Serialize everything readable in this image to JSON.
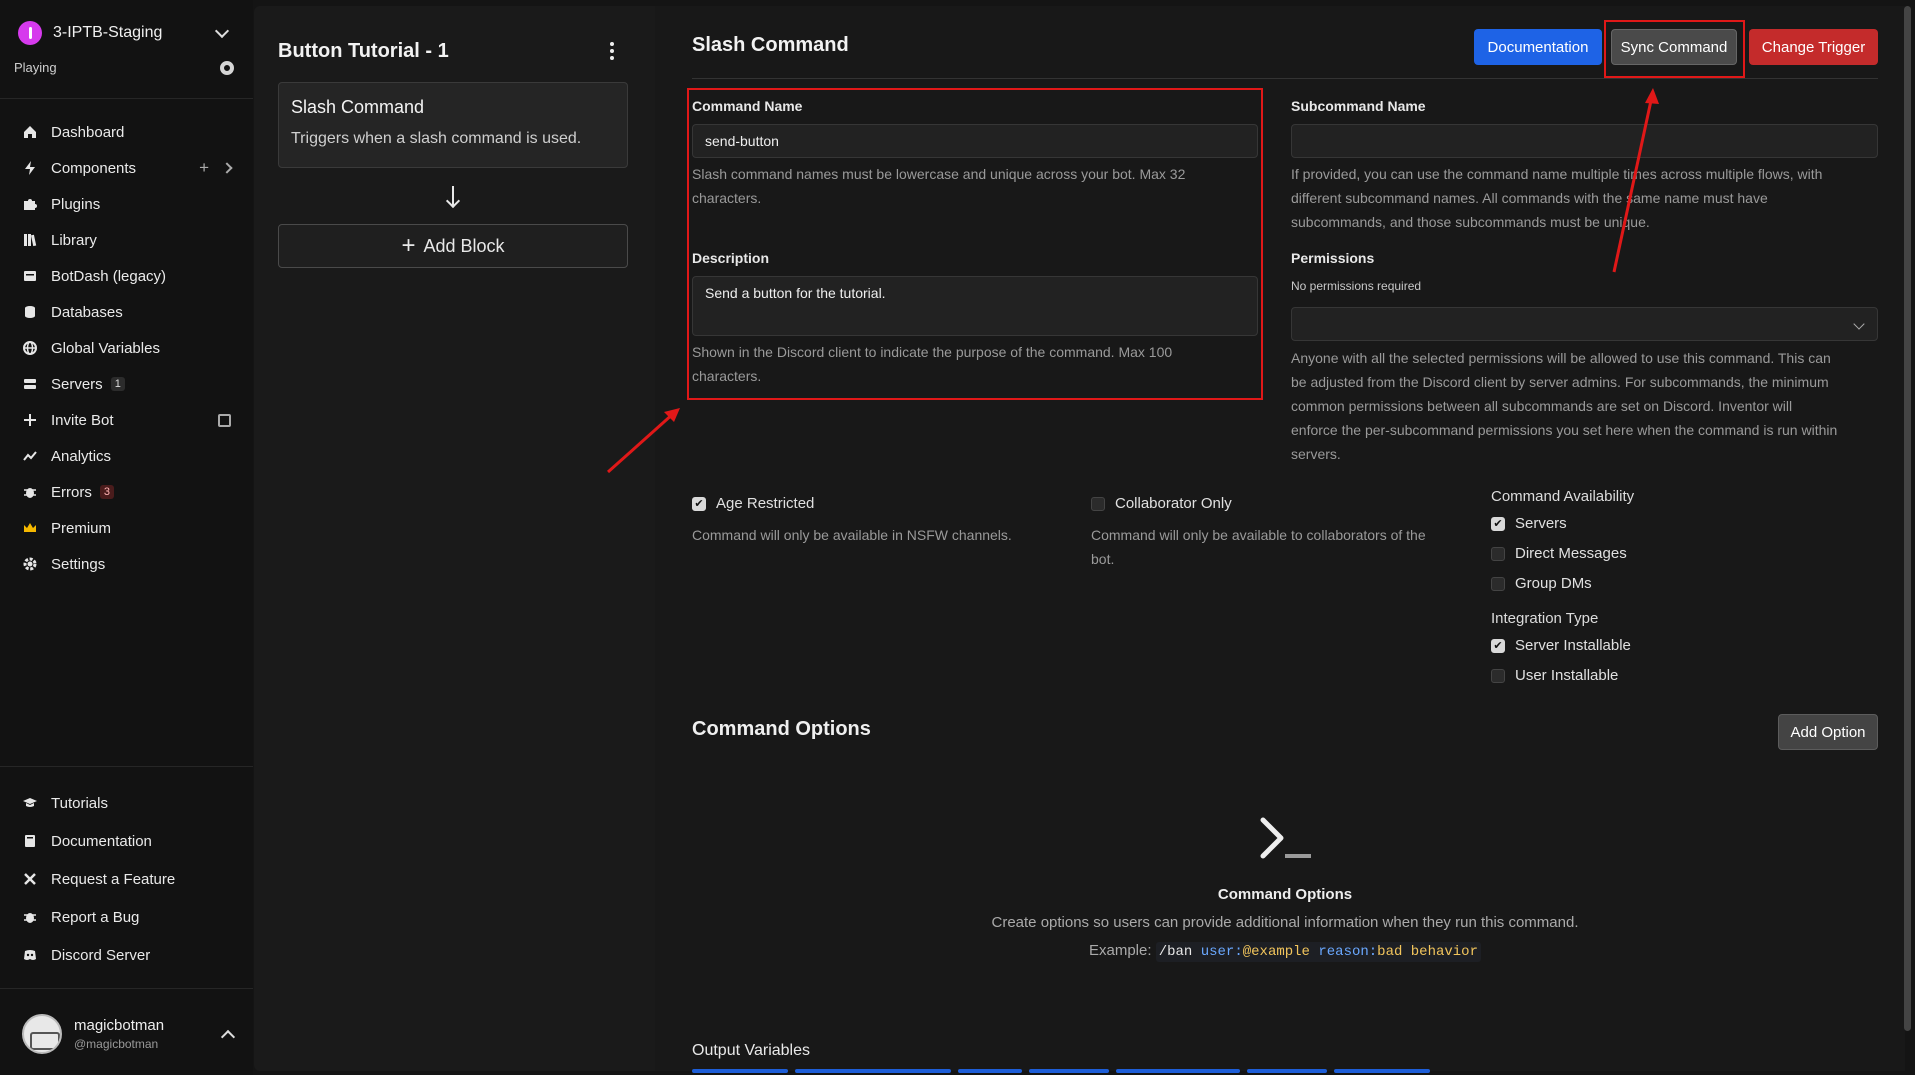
{
  "workspace": {
    "name": "3-IPTB-Staging",
    "status": "Playing"
  },
  "nav": {
    "items": [
      {
        "label": "Dashboard"
      },
      {
        "label": "Components"
      },
      {
        "label": "Plugins"
      },
      {
        "label": "Library"
      },
      {
        "label": "BotDash (legacy)"
      },
      {
        "label": "Databases"
      },
      {
        "label": "Global Variables"
      },
      {
        "label": "Servers",
        "badge": "1"
      },
      {
        "label": "Invite Bot"
      },
      {
        "label": "Analytics"
      },
      {
        "label": "Errors",
        "badge": "3"
      },
      {
        "label": "Premium"
      },
      {
        "label": "Settings"
      }
    ],
    "components_plus": "+"
  },
  "nav_bottom": {
    "items": [
      {
        "label": "Tutorials"
      },
      {
        "label": "Documentation"
      },
      {
        "label": "Request a Feature"
      },
      {
        "label": "Report a Bug"
      },
      {
        "label": "Discord Server"
      }
    ]
  },
  "user": {
    "name": "magicbotman",
    "handle": "@magicbotman"
  },
  "flow": {
    "title": "Button Tutorial - 1",
    "trigger": {
      "title": "Slash Command",
      "description": "Triggers when a slash command is used."
    },
    "add_block": {
      "icon": "+",
      "label": "Add Block"
    }
  },
  "main": {
    "title": "Slash Command",
    "buttons": {
      "documentation": "Documentation",
      "sync": "Sync Command",
      "change_trigger": "Change Trigger"
    },
    "command_name": {
      "label": "Command Name",
      "value": "send-button",
      "help_1": "Slash command names must be lowercase and unique across your bot. Max 32",
      "help_2": "characters."
    },
    "subcommand_name": {
      "label": "Subcommand Name",
      "value": "",
      "help_1": "If provided, you can use the command name multiple times across multiple flows, with",
      "help_2": "different subcommand names. All commands with the same name must have",
      "help_3": "subcommands, and those subcommands must be unique."
    },
    "description": {
      "label": "Description",
      "value": "Send a button for the tutorial.",
      "help_1": "Shown in the Discord client to indicate the purpose of the command. Max 100",
      "help_2": "characters."
    },
    "permissions": {
      "label": "Permissions",
      "sub": "No permissions required",
      "value": "",
      "help_1": "Anyone with all the selected permissions will be allowed to use this command. This can",
      "help_2": "be adjusted from the Discord client by server admins. For subcommands, the minimum",
      "help_3": "common permissions between all subcommands are set on Discord. Inventor will",
      "help_4": "enforce the per-subcommand permissions you set here when the command is run within",
      "help_5": "servers."
    },
    "age_restricted": {
      "label": "Age Restricted",
      "checked": true,
      "help": "Command will only be available in NSFW channels."
    },
    "collaborator_only": {
      "label": "Collaborator Only",
      "checked": false,
      "help_1": "Command will only be available to collaborators of the",
      "help_2": "bot."
    },
    "availability": {
      "title": "Command Availability",
      "options": [
        {
          "label": "Servers",
          "checked": true
        },
        {
          "label": "Direct Messages",
          "checked": false
        },
        {
          "label": "Group DMs",
          "checked": false
        }
      ]
    },
    "integration": {
      "title": "Integration Type",
      "options": [
        {
          "label": "Server Installable",
          "checked": true
        },
        {
          "label": "User Installable",
          "checked": false
        }
      ]
    },
    "options_section": {
      "title": "Command Options",
      "add_label": "Add Option",
      "empty_title": "Command Options",
      "empty_desc": "Create options so users can provide additional information when they run this command.",
      "example_label": "Example:",
      "example_cmd": "/ban",
      "example_k1": "user:",
      "example_v1": "@example",
      "example_k2": "reason:",
      "example_v2": "bad behavior"
    },
    "output_title": "Output Variables"
  },
  "colors": {
    "accent_blue": "#1e63e6",
    "danger": "#c42b2b",
    "annotation_red": "#e01818",
    "background": "#141414"
  },
  "icons": [
    "chevron-down-icon",
    "gear-icon",
    "home-icon",
    "bolt-icon",
    "puzzle-icon",
    "library-icon",
    "database-icon",
    "globe-icon",
    "server-icon",
    "plus-icon",
    "external-link-icon",
    "analytics-icon",
    "bug-icon",
    "crown-icon",
    "graduation-cap-icon",
    "book-icon",
    "tools-icon",
    "discord-icon",
    "kebab-icon",
    "arrow-down-icon",
    "terminal-icon"
  ]
}
